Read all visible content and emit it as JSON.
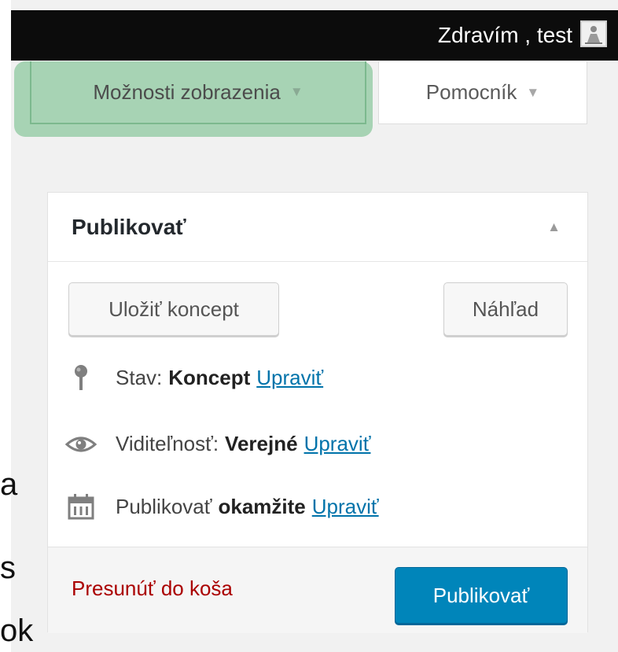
{
  "colors": {
    "admin_bar": "#0c0c0c",
    "highlight": "#a7d3b4",
    "primary_button": "#0085ba",
    "link": "#0073aa",
    "trash_link": "#aa0000"
  },
  "side_text": {
    "char_1": "a",
    "char_2": "s",
    "char_3": "ok"
  },
  "admin_bar": {
    "greeting": "Zdravím , test",
    "avatar_icon": "user-avatar-icon"
  },
  "screen_meta": {
    "screen_options_label": "Možnosti zobrazenia",
    "help_label": "Pomocník",
    "dropdown_arrow": "▼"
  },
  "publish_box": {
    "title": "Publikovať",
    "toggle_arrow": "▲",
    "save_draft_label": "Uložiť koncept",
    "preview_label": "Náhľad",
    "status": {
      "label": "Stav:",
      "value": "Koncept",
      "edit_link": "Upraviť",
      "icon": "pin-icon"
    },
    "visibility": {
      "label": "Viditeľnosť:",
      "value": "Verejné",
      "edit_link": "Upraviť",
      "icon": "eye-icon"
    },
    "schedule": {
      "label": "Publikovať",
      "value": "okamžite",
      "edit_link": "Upraviť",
      "icon": "calendar-icon"
    },
    "trash_label": "Presunúť do koša",
    "publish_label": "Publikovať"
  }
}
